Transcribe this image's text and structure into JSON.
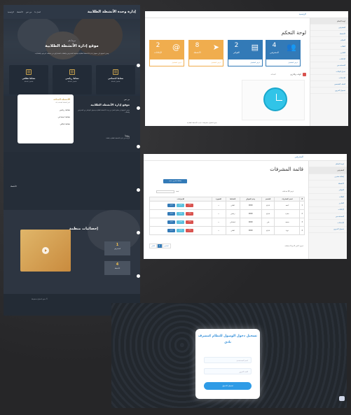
{
  "site": {
    "brand": "إدارة وحدة الأنشطة الطلابية",
    "nav": [
      "الرئيسية",
      "الأنشطة",
      "من نحن",
      "اتصل بنا",
      "تسجيل الدخول"
    ],
    "hero_sub": "مرحباً بكم",
    "hero_title": "موقع إدارة الأنشطة الطلابية",
    "hero_desc": "يهدف الموقع إلى تسهيل إدارة الأنشطة الطلابية ومتابعة المشرفين والطلاب المشاركين في مختلف البرامج والفعاليات",
    "cards": [
      {
        "title": "نشاط ثقافي",
        "desc": "تفاصيل النشاط"
      },
      {
        "title": "نشاط رياضي",
        "desc": "تفاصيل النشاط"
      },
      {
        "title": "نشاط اجتماعي",
        "desc": "تفاصيل النشاط"
      }
    ],
    "about_h": "من نحن",
    "about_title": "موقع إدارة الأنشطة الطلابية",
    "about_p": "يسعى الموقع إلى تنظيم العمل في وحدة الأنشطة الطلابية وتسهيل التواصل بين المشرفين والطلاب",
    "vision_h": "رؤيتنا",
    "vision_p": "الريادة في إدارة الأنشطة الطلابية بكفاءة",
    "wcard_h": "الأنشطة المتاحة",
    "wcard_p": "اختر النشاط المناسب لك",
    "wcard_items": [
      "نشاط رياضي",
      "نشاط اجتماعي",
      "نشاط ثقافي"
    ],
    "section_label": "الأنشطة",
    "stats_h": "إحصائيات منظمة",
    "stats": [
      {
        "n": "1",
        "l": "المشرفين"
      },
      {
        "n": "4",
        "l": "الأنشطة"
      }
    ],
    "footer": "جميع الحقوق محفوظة ©"
  },
  "dashboard": {
    "breadcrumb": "الرئيسية",
    "title": "لوحة التحكم",
    "tiles": [
      {
        "n": "4",
        "name": "المشرفين",
        "color": "#337ab7",
        "icon": "users-icon",
        "glyph": "👥",
        "foot": "عرض التفاصيل"
      },
      {
        "n": "2",
        "name": "الفواتير",
        "color": "#337ab7",
        "icon": "pdf-icon",
        "glyph": "▤",
        "foot": "عرض التفاصيل"
      },
      {
        "n": "8",
        "name": "الأنشطة",
        "color": "#f0ad4e",
        "icon": "send-icon",
        "glyph": "➤",
        "foot": "عرض التفاصيل"
      },
      {
        "n": "2",
        "name": "الإعلانات",
        "color": "#f0ad4e",
        "icon": "at-icon",
        "glyph": "@",
        "foot": "عرض التفاصيل"
      }
    ],
    "settings": "الوقت والتاريخ",
    "clock_label": "الساعة",
    "footer": "جميع الحقوق محفوظة لـ إدارة الأنشطة الطلابية",
    "side": [
      "لوحة التحكم",
      "المشرفين",
      "الأنشطة",
      "الفواتير",
      "الطلاب",
      "التقارير",
      "الإعلانات",
      "المستخدمين",
      "تعديل البيانات",
      "الإعدادات",
      "الملف الشخصي",
      "تسجيل الخروج"
    ]
  },
  "members": {
    "breadcrumb": "المشرفين",
    "title": "قائمة المشرفات",
    "add": "إضافة مشرف جديد",
    "show": "عرض",
    "entries": "مدخلات",
    "search": "بحث:",
    "headers": [
      "#",
      "اسم المشرف",
      "القسم",
      "رقم الجوال",
      "النشاط",
      "الصورة",
      "الإجراءات"
    ],
    "rows": [
      {
        "i": "1",
        "n": "أحمد",
        "d": "اداري",
        "p": "0000",
        "a": "ثقافي",
        "img": "—"
      },
      {
        "i": "2",
        "n": "سارة",
        "d": "اداري",
        "p": "0000",
        "a": "رياضي",
        "img": "—"
      },
      {
        "i": "3",
        "n": "محمد",
        "d": "فني",
        "p": "0000",
        "a": "اجتماعي",
        "img": "—"
      },
      {
        "i": "4",
        "n": "نورة",
        "d": "اداري",
        "p": "0000",
        "a": "ثقافي",
        "img": "—"
      }
    ],
    "btns": [
      "عرض",
      "تعديل",
      "حذف"
    ],
    "prev": "السابق",
    "next": "التالي",
    "page": "1",
    "info": "عرض 1 إلى 4 من 4 مدخلات",
    "side": [
      "لوحة التحكم",
      "المشرفين",
      "إضافة مشرف",
      "الأنشطة",
      "الفواتير",
      "الطلاب",
      "التقارير",
      "الإعلانات",
      "المستخدمين",
      "الإعدادات",
      "تسجيل الخروج"
    ]
  },
  "login": {
    "title": "تسجيل دخول الوصول للنظام كمشرف نادي",
    "user_ph": "اسم المستخدم",
    "pass_ph": "كلمة المرور",
    "button": "تسجيل الدخول"
  }
}
